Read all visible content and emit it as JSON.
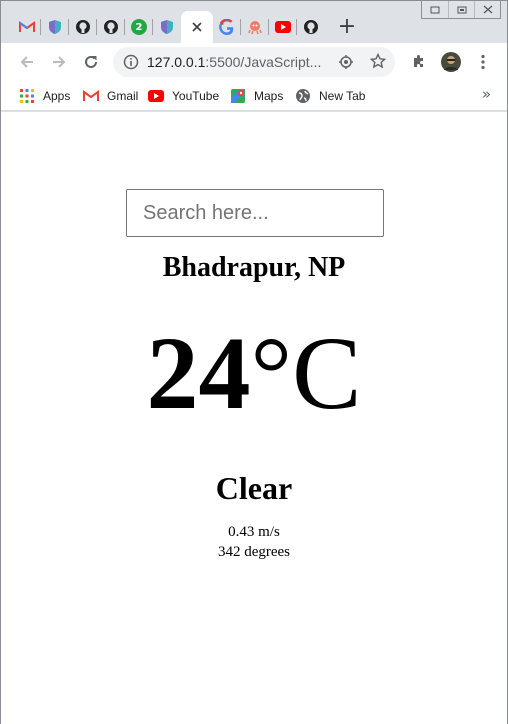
{
  "browser": {
    "tabs": [
      {
        "icon": "gmail-icon"
      },
      {
        "icon": "shield-icon"
      },
      {
        "icon": "github-icon"
      },
      {
        "icon": "github-icon"
      },
      {
        "icon": "badge-icon",
        "badge": "2"
      },
      {
        "icon": "shield-icon"
      },
      {
        "icon": "close-icon",
        "active": true
      },
      {
        "icon": "google-icon"
      },
      {
        "icon": "octopus-icon"
      },
      {
        "icon": "youtube-icon"
      },
      {
        "icon": "github-icon"
      }
    ],
    "new_tab_label": "+",
    "url_host": "127.0.0.1",
    "url_rest": ":5500/JavaScript...",
    "bookmarks": [
      {
        "label": "Apps",
        "icon": "apps-grid-icon"
      },
      {
        "label": "Gmail",
        "icon": "gmail-icon"
      },
      {
        "label": "YouTube",
        "icon": "youtube-icon"
      },
      {
        "label": "Maps",
        "icon": "maps-icon"
      },
      {
        "label": "New Tab",
        "icon": "globe-icon"
      }
    ],
    "bookmarks_overflow": "»"
  },
  "weather": {
    "search_placeholder": "Search here...",
    "city": "Bhadrapur, NP",
    "temperature": "24",
    "unit": "°C",
    "condition": "Clear",
    "wind_speed": "0.43 m/s",
    "wind_direction": "342 degrees"
  },
  "colors": {
    "gmail_red": "#ea4335",
    "youtube_red": "#ff0000",
    "badge_green": "#22a745",
    "shield_teal": "#3fb0c2"
  }
}
